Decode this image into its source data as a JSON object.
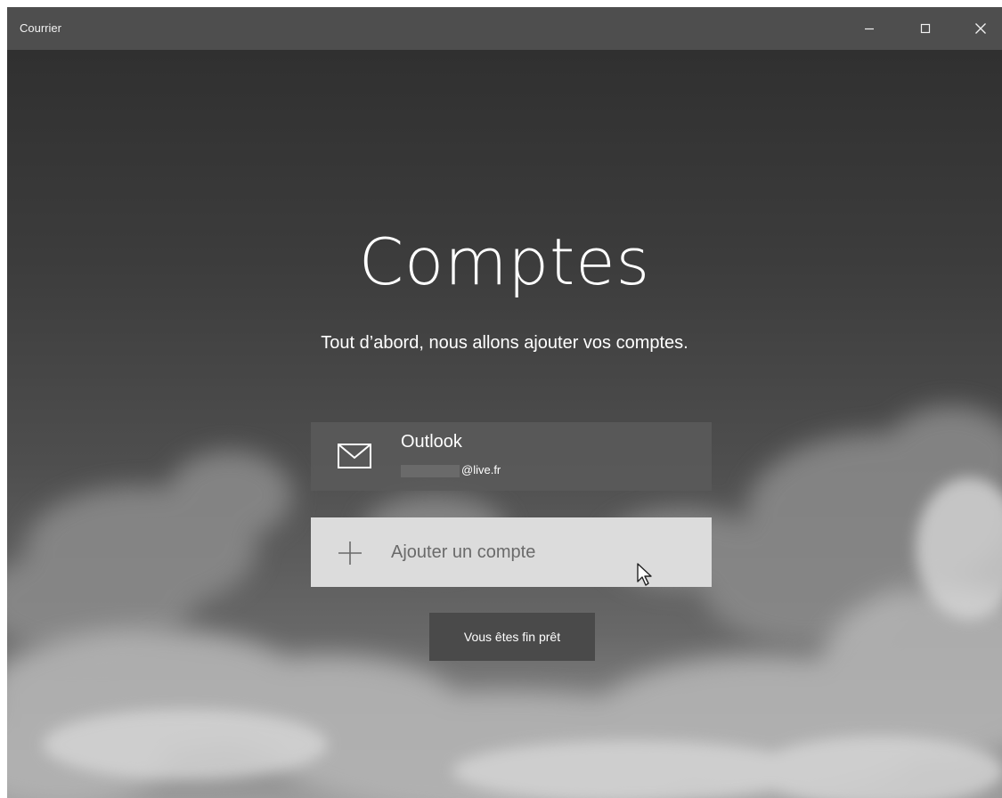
{
  "window": {
    "title": "Courrier",
    "controls": {
      "minimize_icon": "minimize-icon",
      "maximize_icon": "maximize-icon",
      "close_icon": "close-icon"
    }
  },
  "main": {
    "heading": "Comptes",
    "subheading": "Tout d’abord, nous allons ajouter vos comptes.",
    "accounts": [
      {
        "name": "Outlook",
        "email_suffix": "@live.fr",
        "icon": "mail-icon"
      }
    ],
    "add_account": {
      "label": "Ajouter un compte",
      "icon": "plus-icon"
    },
    "ready_button": "Vous êtes fin prêt"
  },
  "colors": {
    "titlebar": "#4e4e4e",
    "add_tile": "#dcdcdc",
    "account_tile": "#5a5a5a",
    "ready_button": "#4a4a4a",
    "text_light": "#ffffff"
  }
}
